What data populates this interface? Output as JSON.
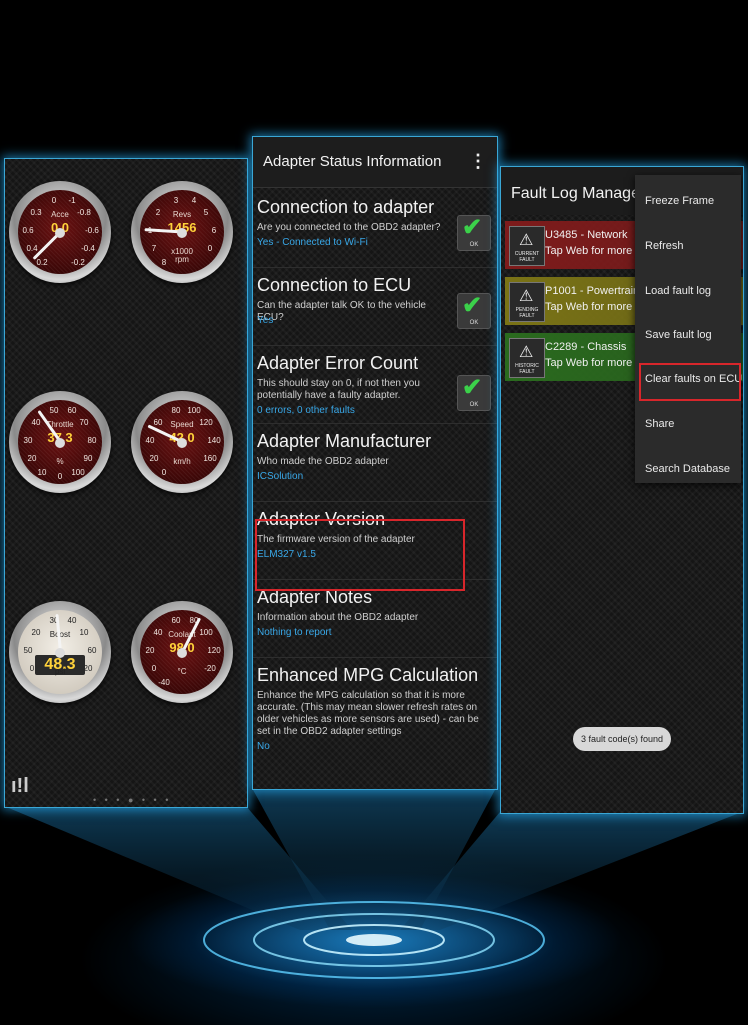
{
  "gauges": [
    {
      "label": "Acce",
      "value": "0.0",
      "unit": "",
      "ticks": [
        "0",
        "-1",
        "0.3",
        "-0.8",
        "0.6",
        "-0.6",
        "0.4",
        "-0.4",
        "0.2",
        "-0.2"
      ],
      "style": "dark"
    },
    {
      "label": "Revs",
      "value": "1456",
      "unit": "x1000\nrpm",
      "ticks": [
        "3",
        "4",
        "2",
        "5",
        "1",
        "6",
        "7",
        "0",
        "8"
      ],
      "style": "dark"
    },
    {
      "label": "Throttle",
      "value": "37.3",
      "unit": "%",
      "ticks": [
        "50",
        "60",
        "40",
        "70",
        "30",
        "80",
        "20",
        "90",
        "10",
        "100",
        "0"
      ],
      "style": "dark"
    },
    {
      "label": "Speed",
      "value": "42.0",
      "unit": "km/h",
      "ticks": [
        "80",
        "100",
        "60",
        "120",
        "40",
        "140",
        "20",
        "160",
        "0"
      ],
      "style": "dark"
    },
    {
      "label": "Boost",
      "value": "48.3",
      "unit": "psi",
      "ticks": [
        "30",
        "40",
        "20",
        "10",
        "50",
        "60",
        "0",
        "20"
      ],
      "style": "light"
    },
    {
      "label": "Coolant",
      "value": "98.0",
      "unit": "°C",
      "ticks": [
        "60",
        "80",
        "40",
        "100",
        "20",
        "120",
        "0",
        "-20",
        "-40"
      ],
      "style": "dark"
    }
  ],
  "gauge_levels": [
    0.0,
    0.18,
    0.37,
    0.26,
    0.48,
    0.6
  ],
  "pager": "• • • ● • • •",
  "status_panel": {
    "title": "Adapter Status Information",
    "menu_icon": "kebab-icon",
    "ok_label": "OK",
    "items": [
      {
        "title": "Connection to adapter",
        "desc": "Are you connected to the OBD2 adapter?",
        "value": "Yes - Connected to Wi-Fi",
        "ok": true
      },
      {
        "title": "Connection to ECU",
        "desc": "Can the adapter talk OK to the vehicle ECU?",
        "value": "Yes",
        "ok": true
      },
      {
        "title": "Adapter Error Count",
        "desc": "This should stay on 0, if not then you potentially have a faulty adapter.",
        "value": "0 errors, 0 other faults",
        "ok": true
      },
      {
        "title": "Adapter Manufacturer",
        "desc": "Who made the OBD2 adapter",
        "value": "ICSolution",
        "ok": false
      },
      {
        "title": "Adapter Version",
        "desc": "The firmware version of the adapter",
        "value": "ELM327 v1.5",
        "ok": false
      },
      {
        "title": "Adapter Notes",
        "desc": "Information about the OBD2 adapter",
        "value": "Nothing to report",
        "ok": false
      },
      {
        "title": "Enhanced MPG Calculation",
        "desc": "Enhance the MPG calculation so that it is more accurate. (This may mean slower refresh rates on older vehicles as more sensors are used) - can be set in the OBD2 adapter settings",
        "value": "No",
        "ok": false
      }
    ]
  },
  "fault_panel": {
    "title": "Fault Log Manager",
    "faults": [
      {
        "code": "U3485 - Network",
        "tap": "Tap Web for more info",
        "badge": "CURRENT\nFAULT",
        "color": "#7e1b1b"
      },
      {
        "code": "P1001 - Powertrain",
        "tap": "Tap Web for more info",
        "badge": "PENDING\nFAULT",
        "color": "#7a7316"
      },
      {
        "code": "C2289 - Chassis",
        "tap": "Tap Web for more info",
        "badge": "HISTORIC\nFAULT",
        "color": "#2a6a1e"
      }
    ],
    "menu": [
      "Freeze Frame",
      "Refresh",
      "Load fault log",
      "Save fault log",
      "Clear faults on ECU",
      "Share",
      "Search Database"
    ],
    "found": "3 fault code(s) found"
  }
}
